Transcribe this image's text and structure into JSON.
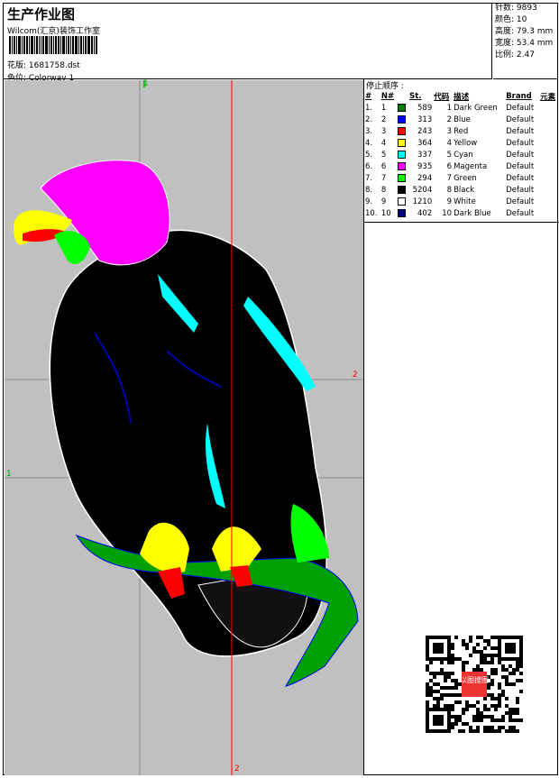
{
  "header": {
    "title": "生产作业图",
    "company": "Wilcom(汇京)装饰工作室",
    "design": "花版: 1681758.dst",
    "colorway": "色位: Colorway 1"
  },
  "stats": {
    "stitches": "针数: 9893",
    "colors": "颜色: 10",
    "height": "高度: 79.3 mm",
    "width": "宽度: 53.4 mm",
    "scale": "比例: 2.47"
  },
  "stop_sequence": {
    "title": "停止顺序 :",
    "columns": [
      "#",
      "N#",
      "",
      "St.",
      "代码",
      "描述",
      "Brand",
      "元素"
    ],
    "rows": [
      {
        "idx": "1.",
        "n": "1",
        "color": "#008000",
        "st": "589",
        "code": "1",
        "desc": "Dark Green",
        "brand": "Default"
      },
      {
        "idx": "2.",
        "n": "2",
        "color": "#0000ff",
        "st": "313",
        "code": "2",
        "desc": "Blue",
        "brand": "Default"
      },
      {
        "idx": "3.",
        "n": "3",
        "color": "#ff0000",
        "st": "243",
        "code": "3",
        "desc": "Red",
        "brand": "Default"
      },
      {
        "idx": "4.",
        "n": "4",
        "color": "#ffff00",
        "st": "364",
        "code": "4",
        "desc": "Yellow",
        "brand": "Default"
      },
      {
        "idx": "5.",
        "n": "5",
        "color": "#00ffff",
        "st": "337",
        "code": "5",
        "desc": "Cyan",
        "brand": "Default"
      },
      {
        "idx": "6.",
        "n": "6",
        "color": "#ff00ff",
        "st": "935",
        "code": "6",
        "desc": "Magenta",
        "brand": "Default"
      },
      {
        "idx": "7.",
        "n": "7",
        "color": "#00ff00",
        "st": "294",
        "code": "7",
        "desc": "Green",
        "brand": "Default"
      },
      {
        "idx": "8.",
        "n": "8",
        "color": "#000000",
        "st": "5204",
        "code": "8",
        "desc": "Black",
        "brand": "Default"
      },
      {
        "idx": "9.",
        "n": "9",
        "color": "#ffffff",
        "st": "1210",
        "code": "9",
        "desc": "White",
        "brand": "Default"
      },
      {
        "idx": "10.",
        "n": "10",
        "color": "#000080",
        "st": "402",
        "code": "10",
        "desc": "Dark Blue",
        "brand": "Default"
      }
    ]
  },
  "canvas": {
    "guide_labels": {
      "top": "1",
      "left": "1",
      "right": "2",
      "bottom": "2"
    },
    "qr_label": "以图搜图"
  }
}
